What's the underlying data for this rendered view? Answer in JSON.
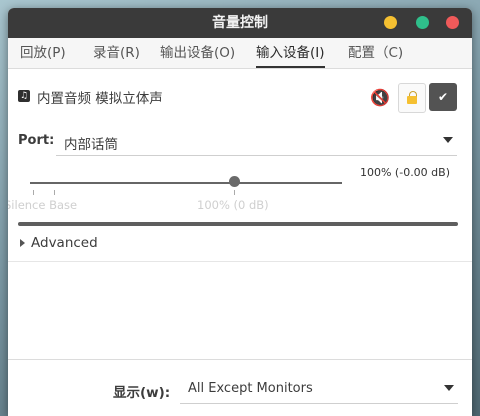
{
  "window": {
    "title": "音量控制"
  },
  "tabs": [
    {
      "label": "回放(P)"
    },
    {
      "label": "录音(R)"
    },
    {
      "label": "输出设备(O)"
    },
    {
      "label": "输入设备(I)"
    },
    {
      "label": "配置（C)"
    }
  ],
  "active_tab": 3,
  "device": {
    "name": "内置音频 模拟立体声",
    "port_label": "Port:",
    "port_value": "内部话筒",
    "volume_text": "100% (-0.00 dB)",
    "volume_level": 1.0,
    "mark_silence": "Silence",
    "mark_base": "Base",
    "mark_100": "100% (0 dB)",
    "advanced_label": "Advanced",
    "locked": true,
    "default_checked": true
  },
  "footer": {
    "show_label": "显示(w):",
    "show_value": "All Except Monitors"
  },
  "colors": {
    "titlebar": "#3a3a3a",
    "minimize": "#f5c031",
    "maximize": "#2fbf8b",
    "close": "#ef5a5a"
  },
  "icons": {
    "device": "music-note-icon",
    "mute": "speaker-mute-icon",
    "lock": "lock-icon",
    "check": "check-icon"
  }
}
